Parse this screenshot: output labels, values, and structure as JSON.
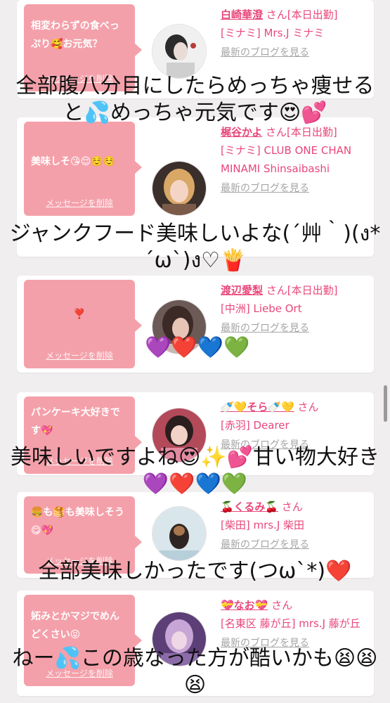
{
  "cards": [
    {
      "message": "相変わらずの食べっぷり🥰お元気？",
      "delete_label": "メッセージを削除",
      "name": "白崎華澄",
      "suffix": "さん[本日出勤]",
      "shop": "[ミナミ] Mrs.J ミナミ",
      "blog_link": "最新のブログを見る"
    },
    {
      "message": "美味しそ😘😌☺️☺️",
      "delete_label": "メッセージを削除",
      "name": "梶谷かよ",
      "suffix": "さん[本日出勤]",
      "shop": "[ミナミ] CLUB ONE CHAN MINAMI Shinsaibashi",
      "blog_link": "最新のブログを見る"
    },
    {
      "message": "❣️",
      "delete_label": "メッセージを削除",
      "name": "渡辺愛梨",
      "suffix": "さん[本日出勤]",
      "shop": "[中洲] Liebe Ort",
      "blog_link": "最新のブログを見る"
    },
    {
      "message": "パンケーキ大好きです💖",
      "delete_label": "メッセージを削除",
      "name": "🍼💛そら🍼💛",
      "suffix": "さん",
      "shop": "[赤羽] Dearer",
      "blog_link": "最新のブログを見る"
    },
    {
      "message": "🍔も🥞も美味しそう😋💖",
      "delete_label": "メッセージを削除",
      "name": "🍒くるみ🍒",
      "suffix": "さん",
      "shop": "[柴田] mrs.J 柴田",
      "blog_link": "最新のブログを見る"
    },
    {
      "message": "妬みとかマジでめんどくさい😝",
      "delete_label": "メッセージを削除",
      "name": "💝なお💝",
      "suffix": "さん",
      "shop": "[名東区 藤が丘] mrs.J 藤が丘",
      "blog_link": "最新のブログを見る"
    }
  ],
  "captions": [
    "全部腹八分目にしたらめっちゃ痩せると💦めっちゃ元気です😍💕",
    "ジャンクフード美味しいよな(´艸｀)(ง*´ω`)ง♡🍟",
    "💜❤️💙💚",
    "美味しいですよね😍✨💕甘い物大好き💜❤️💙💚",
    "全部美味しかったです(つω`*)❤️",
    "ねー💦この歳なった方が酷いかも😫😫😫"
  ]
}
